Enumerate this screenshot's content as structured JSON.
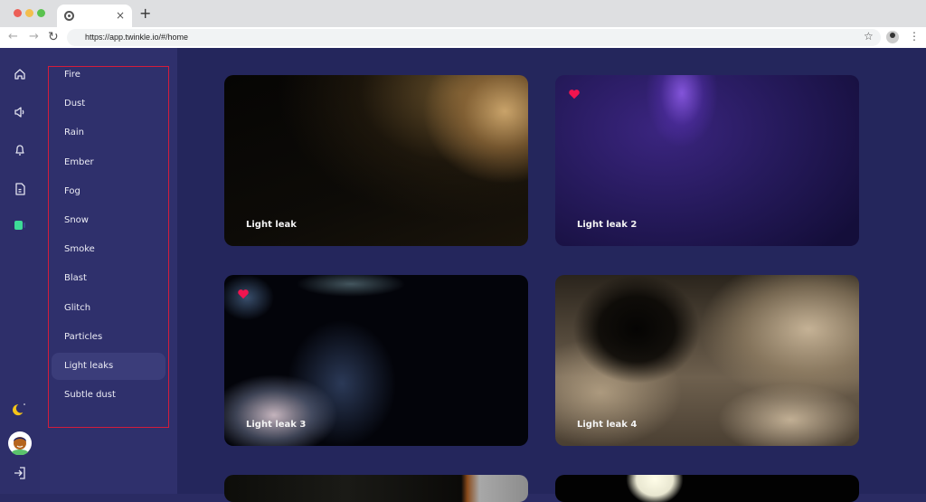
{
  "browser": {
    "url": "https://app.twinkle.io/#/home",
    "tab_close": "×",
    "new_tab": "+",
    "back": "←",
    "forward": "→",
    "reload": "C",
    "bookmark": "☆",
    "menu": "⋮"
  },
  "rail": {
    "items": [
      {
        "icon": "home-icon"
      },
      {
        "icon": "speaker-icon"
      },
      {
        "icon": "bell-icon"
      },
      {
        "icon": "document-icon"
      },
      {
        "icon": "video-icon",
        "active": true,
        "color": "#3ddc97"
      }
    ],
    "bottom": [
      {
        "icon": "moon-icon",
        "color": "#f5c518"
      },
      {
        "icon": "avatar"
      },
      {
        "icon": "logout-icon"
      }
    ]
  },
  "categories": {
    "items": [
      {
        "label": "Fire"
      },
      {
        "label": "Dust"
      },
      {
        "label": "Rain"
      },
      {
        "label": "Ember"
      },
      {
        "label": "Fog"
      },
      {
        "label": "Snow"
      },
      {
        "label": "Smoke"
      },
      {
        "label": "Blast"
      },
      {
        "label": "Glitch"
      },
      {
        "label": "Particles"
      },
      {
        "label": "Light leaks",
        "active": true
      },
      {
        "label": "Subtle dust"
      }
    ],
    "highlight_color": "#d31c3c"
  },
  "cards": [
    {
      "title": "Light leak",
      "favorite": false
    },
    {
      "title": "Light leak 2",
      "favorite": true
    },
    {
      "title": "Light leak 3",
      "favorite": true
    },
    {
      "title": "Light leak 4",
      "favorite": false
    }
  ],
  "colors": {
    "favorite": "#f0144f",
    "background": "#24265c"
  }
}
